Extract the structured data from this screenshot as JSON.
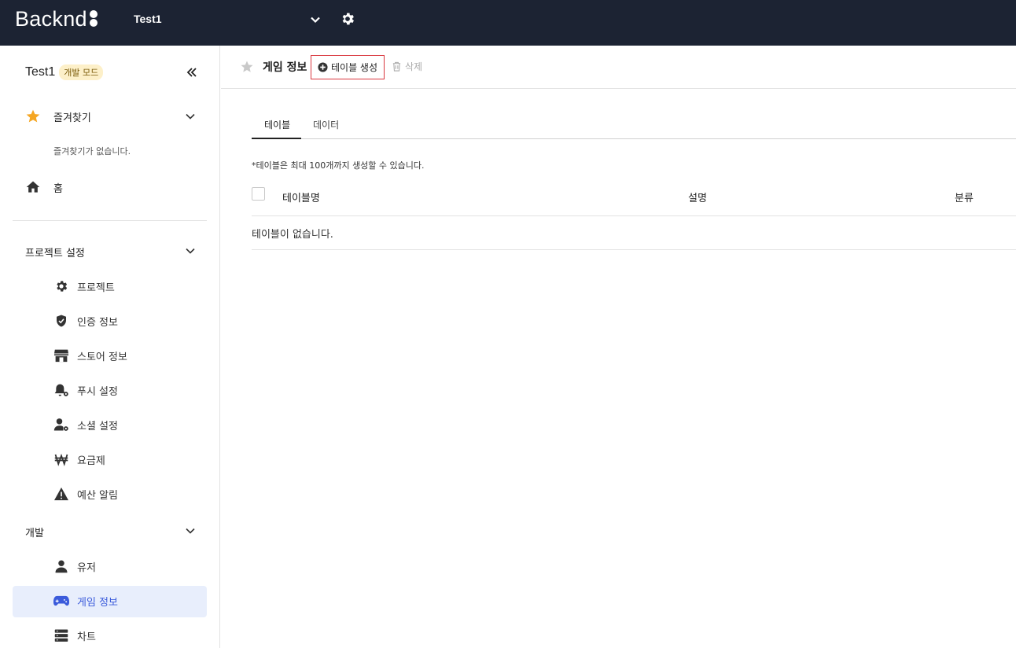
{
  "topbar": {
    "logo_text": "Backnd",
    "project_name": "Test1",
    "colors": {
      "bg": "#1c2333"
    }
  },
  "sidebar": {
    "project_name": "Test1",
    "mode_badge": "개발 모드",
    "favorites_label": "즐겨찾기",
    "favorites_empty": "즐겨찾기가 없습니다.",
    "home_label": "홈",
    "project_settings_label": "프로젝트 설정",
    "project_settings_items": [
      {
        "label": "프로젝트",
        "icon": "gear-icon"
      },
      {
        "label": "인증 정보",
        "icon": "shield-check-icon"
      },
      {
        "label": "스토어 정보",
        "icon": "store-icon"
      },
      {
        "label": "푸시 설정",
        "icon": "bell-gear-icon"
      },
      {
        "label": "소셜 설정",
        "icon": "user-gear-icon"
      },
      {
        "label": "요금제",
        "icon": "won-icon"
      },
      {
        "label": "예산 알림",
        "icon": "warning-icon"
      }
    ],
    "dev_label": "개발",
    "dev_items": [
      {
        "label": "유저",
        "icon": "user-icon"
      },
      {
        "label": "게임 정보",
        "icon": "gamepad-icon",
        "active": true
      },
      {
        "label": "차트",
        "icon": "server-icon"
      }
    ],
    "colors": {
      "active_bg": "#e8eefc",
      "active_text": "#3b5bdb",
      "star": "#f5a623"
    }
  },
  "main": {
    "title": "게임 정보",
    "create_button": "테이블 생성",
    "delete_button": "삭제",
    "tabs": [
      {
        "label": "테이블",
        "active": true
      },
      {
        "label": "데이터",
        "active": false
      }
    ],
    "notice": "*테이블은 최대 100개까지 생성할 수 있습니다.",
    "table": {
      "columns": [
        "테이블명",
        "설명",
        "분류"
      ],
      "empty_text": "테이블이 없습니다."
    },
    "colors": {
      "highlight_border": "#d9363e"
    }
  }
}
